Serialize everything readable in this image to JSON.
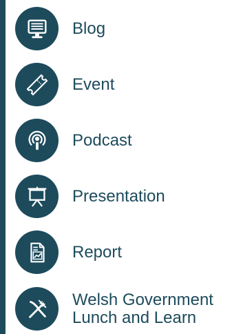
{
  "brand_color": "#1d4b5c",
  "items": [
    {
      "label": "Blog",
      "icon": "desktop-monitor-icon"
    },
    {
      "label": "Event",
      "icon": "ticket-icon"
    },
    {
      "label": "Podcast",
      "icon": "podcast-microphone-icon"
    },
    {
      "label": "Presentation",
      "icon": "presentation-easel-icon"
    },
    {
      "label": "Report",
      "icon": "report-document-chart-icon"
    },
    {
      "label_line1": "Welsh Government",
      "label_line2": "Lunch and Learn",
      "icon": "fork-knife-icon"
    }
  ]
}
